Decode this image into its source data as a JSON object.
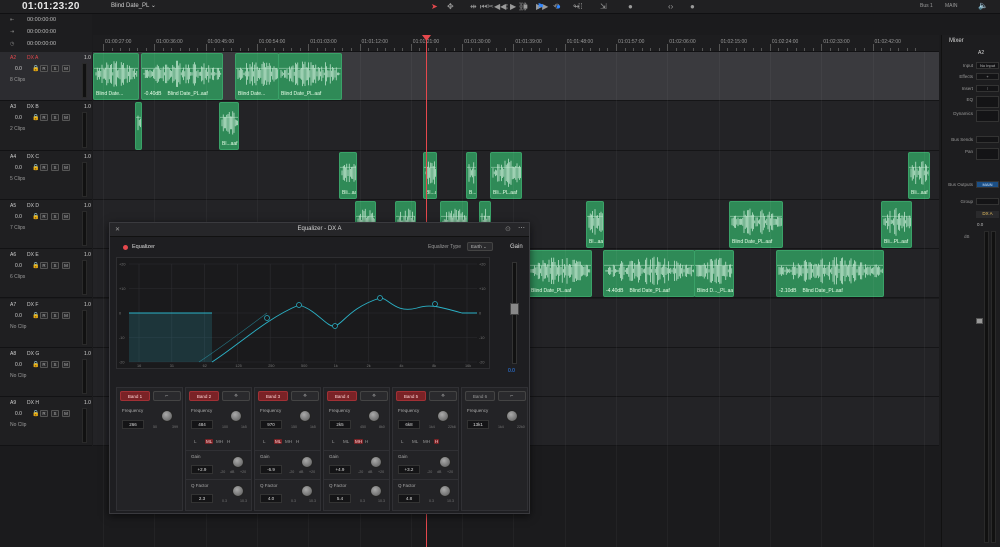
{
  "header": {
    "timecode": "01:01:23:20",
    "timeline_name": "Blind Date_PL",
    "bus_label": "Bus 1",
    "main_label": "MAIN"
  },
  "timecode_panel": [
    {
      "icon": "in-point-icon",
      "glyph": "⇤",
      "value": "00:00:00:00"
    },
    {
      "icon": "out-point-icon",
      "glyph": "⇥",
      "value": "00:00:00:00"
    },
    {
      "icon": "duration-icon",
      "glyph": "◷",
      "value": "00:00:00:00"
    }
  ],
  "tracks": [
    {
      "id": "A2",
      "name": "DX A",
      "db": "1.0",
      "vol": "0.0",
      "clips": "8 Clips",
      "selected": true
    },
    {
      "id": "A3",
      "name": "DX B",
      "db": "1.0",
      "vol": "0.0",
      "clips": "2 Clips",
      "selected": false
    },
    {
      "id": "A4",
      "name": "DX C",
      "db": "1.0",
      "vol": "0.0",
      "clips": "5 Clips",
      "selected": false
    },
    {
      "id": "A5",
      "name": "DX D",
      "db": "1.0",
      "vol": "0.0",
      "clips": "7 Clips",
      "selected": false
    },
    {
      "id": "A6",
      "name": "DX E",
      "db": "1.0",
      "vol": "0.0",
      "clips": "6 Clips",
      "selected": false
    },
    {
      "id": "A7",
      "name": "DX F",
      "db": "1.0",
      "vol": "0.0",
      "clips": "No Clip",
      "selected": false
    },
    {
      "id": "A8",
      "name": "DX G",
      "db": "1.0",
      "vol": "0.0",
      "clips": "No Clip",
      "selected": false
    },
    {
      "id": "A9",
      "name": "DX H",
      "db": "1.0",
      "vol": "0.0",
      "clips": "No Clip",
      "selected": false
    }
  ],
  "track_buttons": [
    "R",
    "S",
    "M"
  ],
  "ruler_labels": [
    "01:00:27:00",
    "01:00:36:00",
    "01:00:45:00",
    "01:00:54:00",
    "01:01:03:00",
    "01:01:12:00",
    "01:01:21:00",
    "01:01:30:00",
    "01:01:39:00",
    "01:01:48:00",
    "01:01:57:00",
    "01:02:06:00",
    "01:02:15:00",
    "01:02:24:00",
    "01:02:33:00",
    "01:02:42:00"
  ],
  "clips": [
    {
      "track": 0,
      "name": "Blind Date...",
      "db": ""
    },
    {
      "track": 0,
      "name": "Blind Date_PL.aaf",
      "db": "-0.40dB"
    },
    {
      "track": 0,
      "name": "Blind Date...",
      "db": ""
    },
    {
      "track": 0,
      "name": "Blind Date_PL.aaf",
      "db": ""
    },
    {
      "track": 1,
      "name": "",
      "db": ""
    },
    {
      "track": 1,
      "name": "Bl...aaf",
      "db": ""
    },
    {
      "track": 2,
      "name": "Bli...aaf",
      "db": ""
    },
    {
      "track": 2,
      "name": "Bl...aaf",
      "db": ""
    },
    {
      "track": 2,
      "name": "B...f",
      "db": ""
    },
    {
      "track": 2,
      "name": "Bli...PL.aaf",
      "db": ""
    },
    {
      "track": 2,
      "name": "Bli...aaf",
      "db": ""
    },
    {
      "track": 3,
      "name": "",
      "db": ""
    },
    {
      "track": 3,
      "name": "",
      "db": ""
    },
    {
      "track": 3,
      "name": "",
      "db": ""
    },
    {
      "track": 3,
      "name": "",
      "db": ""
    },
    {
      "track": 3,
      "name": "Bl...aaf",
      "db": ""
    },
    {
      "track": 3,
      "name": "Blind Date_PL.aaf",
      "db": ""
    },
    {
      "track": 3,
      "name": "Bli...PL.aaf",
      "db": ""
    },
    {
      "track": 4,
      "name": "Blind Date_PL.aaf",
      "db": ""
    },
    {
      "track": 4,
      "name": "Blind Date_PL.aaf",
      "db": "-4.40dB"
    },
    {
      "track": 4,
      "name": "Blind D..._PL.aaf",
      "db": ""
    },
    {
      "track": 4,
      "name": "Blind Date_PL.aaf",
      "db": "-2.10dB"
    }
  ],
  "mixer": {
    "title": "Mixer",
    "channel": "A2",
    "rows": [
      {
        "label": "Input",
        "value": "No Input"
      },
      {
        "label": "Effects",
        "value": "+"
      },
      {
        "label": "Insert",
        "value": "⁝"
      },
      {
        "label": "EQ",
        "value": ""
      },
      {
        "label": "Dynamics",
        "value": ""
      },
      {
        "label": "Bus Sends",
        "value": ""
      },
      {
        "label": "Pan",
        "value": ""
      },
      {
        "label": "Bus Outputs",
        "value": "MAIN"
      },
      {
        "label": "Group",
        "value": ""
      }
    ],
    "channel_name": "DX A",
    "db_value": "0.0",
    "db_label": "dB"
  },
  "equalizer": {
    "title": "Equalizer - DX A",
    "label": "Equalizer",
    "type_label": "Equalizer Type",
    "type_value": "Earth",
    "gain_label": "Gain",
    "gain_value": "0.0",
    "y_labels_left": [
      "+20",
      "+10",
      "0",
      "-10",
      "-20"
    ],
    "y_labels_right": [
      "+20",
      "+10",
      "0",
      "-10",
      "-20"
    ],
    "x_labels": [
      "16",
      "31",
      "62",
      "125",
      "250",
      "500",
      "1k",
      "2k",
      "4k",
      "8k",
      "16k"
    ],
    "curve_color": "#2bb3c8",
    "bands": [
      {
        "name": "Band 1",
        "enabled": true,
        "shape": "⌐",
        "freq": "266",
        "freq_min": "50",
        "freq_max": "399",
        "has_gain": false
      },
      {
        "name": "Band 2",
        "enabled": true,
        "shape": "⟡",
        "freq": "484",
        "freq_min": "100",
        "freq_max": "1k5",
        "filters": [
          "L",
          "ML",
          "MH",
          "H"
        ],
        "active": "ML",
        "has_gain": true,
        "gain": "+2.9",
        "q": "2.3"
      },
      {
        "name": "Band 3",
        "enabled": true,
        "shape": "⟡",
        "freq": "970",
        "freq_min": "150",
        "freq_max": "1k5",
        "filters": [
          "L",
          "ML",
          "MH",
          "H"
        ],
        "active": "ML",
        "has_gain": true,
        "gain": "-6.9",
        "q": "4.0"
      },
      {
        "name": "Band 4",
        "enabled": true,
        "shape": "⟡",
        "freq": "2k5",
        "freq_min": "450",
        "freq_max": "8k0",
        "filters": [
          "L",
          "ML",
          "MH",
          "H"
        ],
        "active": "MH",
        "has_gain": true,
        "gain": "+4.9",
        "q": "5.4"
      },
      {
        "name": "Band 5",
        "enabled": true,
        "shape": "⟡",
        "freq": "6k8",
        "freq_min": "1k4",
        "freq_max": "22k6",
        "filters": [
          "L",
          "ML",
          "MH",
          "H"
        ],
        "active": "H",
        "has_gain": true,
        "gain": "+3.2",
        "q": "4.8"
      },
      {
        "name": "Band 6",
        "enabled": false,
        "shape": "⌐",
        "freq": "13k1",
        "freq_min": "1k4",
        "freq_max": "22k0",
        "has_gain": false
      }
    ],
    "gain_range": {
      "min": "-20",
      "mid": "dB",
      "max": "+20"
    },
    "q_range": {
      "min": "0.3",
      "max": "10.3"
    },
    "freq_label": "Frequency",
    "gain_title": "Gain",
    "q_title": "Q Factor"
  }
}
